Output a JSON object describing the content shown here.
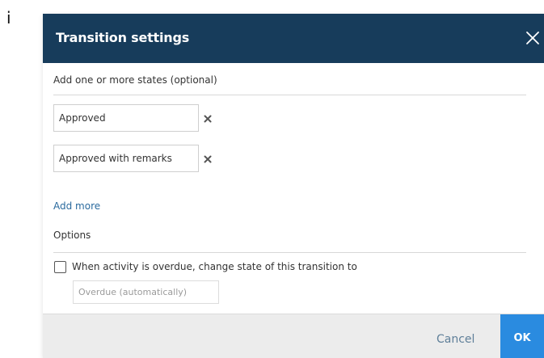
{
  "stray_text": "i",
  "dialog": {
    "title": "Transition settings",
    "close_icon": "close-icon"
  },
  "states_section": {
    "label": "Add one or more states (optional)",
    "states": [
      {
        "value": "Approved"
      },
      {
        "value": "Approved with remarks"
      }
    ],
    "remove_icon": "remove-x-icon",
    "add_more_label": "Add more"
  },
  "options_section": {
    "label": "Options",
    "overdue_checkbox_label": "When activity is overdue, change state of this transition to",
    "overdue_checked": false,
    "overdue_select_value": "Overdue (automatically)"
  },
  "footer": {
    "cancel_label": "Cancel",
    "ok_label": "OK"
  },
  "colors": {
    "header_bg": "#173c5b",
    "ok_bg": "#2a8be0",
    "link": "#2a6a9e",
    "footer_bg": "#ececec"
  }
}
